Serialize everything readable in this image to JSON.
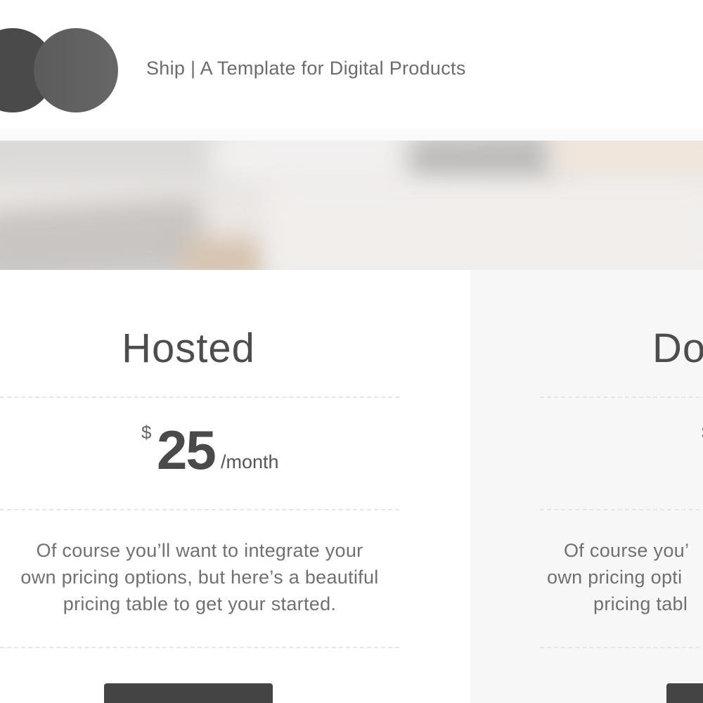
{
  "header": {
    "title": "Ship | A Template for Digital Products"
  },
  "plans": [
    {
      "name": "Hosted",
      "currency": "$",
      "amount": "25",
      "period": "/month",
      "description_lines": [
        "Of course you’ll want to integrate your",
        "own pricing options, but here’s a beautiful",
        "pricing table to get your started."
      ],
      "button_label": ""
    },
    {
      "name": "Do",
      "currency": "$",
      "amount": "",
      "period": "",
      "description_lines": [
        "Of course you’",
        "own pricing opti",
        "pricing tabl"
      ],
      "button_label": ""
    }
  ],
  "colors": {
    "logo_dark": "#4a4a4a",
    "logo_light": "#616161",
    "button": "#444444",
    "alt_column_bg": "#f7f7f7"
  }
}
